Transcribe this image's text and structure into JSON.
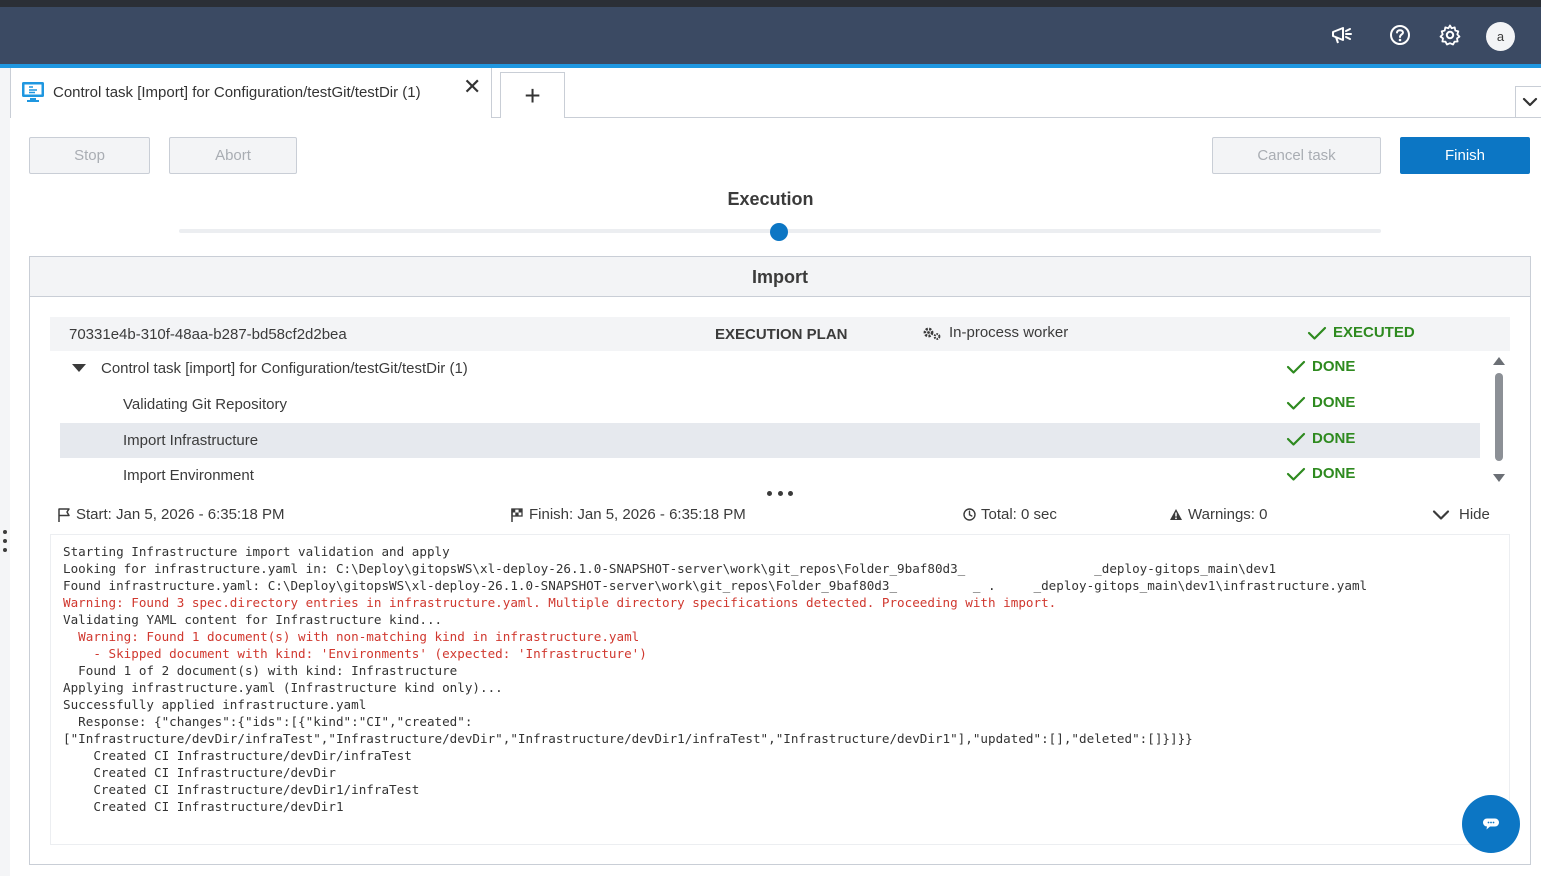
{
  "header": {
    "avatar_letter": "a",
    "icons": [
      "megaphone-icon",
      "help-icon",
      "settings-gear-icon"
    ]
  },
  "tabs": {
    "active_label": "Control task [Import] for Configuration/testGit/testDir (1)",
    "close_glyph": "✕",
    "add_glyph": "+"
  },
  "toolbar": {
    "stop_label": "Stop",
    "abort_label": "Abort",
    "cancel_label": "Cancel task",
    "finish_label": "Finish"
  },
  "stepper": {
    "current_step": "Execution"
  },
  "panel": {
    "title": "Import",
    "plan": {
      "id": "70331e4b-310f-48aa-b287-bd58cf2d2bea",
      "label": "EXECUTION PLAN",
      "worker": "In-process worker",
      "state": "EXECUTED"
    },
    "steps": [
      {
        "label": "Control task [import] for Configuration/testGit/testDir (1)",
        "status": "DONE"
      },
      {
        "label": "Validating Git Repository",
        "status": "DONE"
      },
      {
        "label": "Import Infrastructure",
        "status": "DONE"
      },
      {
        "label": "Import Environment",
        "status": "DONE"
      }
    ],
    "info": {
      "start": "Start: Jan 5, 2026 - 6:35:18 PM",
      "finish": "Finish: Jan 5, 2026 - 6:35:18 PM",
      "total": "Total: 0 sec",
      "warnings": "Warnings: 0",
      "hide_label": "Hide"
    },
    "log": [
      "Starting Infrastructure import validation and apply",
      "Looking for infrastructure.yaml in: C:\\Deploy\\gitopsWS\\xl-deploy-26.1.0-SNAPSHOT-server\\work\\git_repos\\Folder_9baf80d3_                 _deploy-gitops_main\\dev1",
      "Found infrastructure.yaml: C:\\Deploy\\gitopsWS\\xl-deploy-26.1.0-SNAPSHOT-server\\work\\git_repos\\Folder_9baf80d3_          _ .     _deploy-gitops_main\\dev1\\infrastructure.yaml",
      "Warning: Found 3 spec.directory entries in infrastructure.yaml. Multiple directory specifications detected. Proceeding with import.",
      "Validating YAML content for Infrastructure kind...",
      "  Warning: Found 1 document(s) with non-matching kind in infrastructure.yaml",
      "    - Skipped document with kind: 'Environments' (expected: 'Infrastructure')",
      "  Found 1 of 2 document(s) with kind: Infrastructure",
      "Applying infrastructure.yaml (Infrastructure kind only)...",
      "Successfully applied infrastructure.yaml",
      "  Response: {\"changes\":{\"ids\":[{\"kind\":\"CI\",\"created\":",
      "[\"Infrastructure/devDir/infraTest\",\"Infrastructure/devDir\",\"Infrastructure/devDir1/infraTest\",\"Infrastructure/devDir1\"],\"updated\":[],\"deleted\":[]}]}}",
      "    Created CI Infrastructure/devDir/infraTest",
      "    Created CI Infrastructure/devDir",
      "    Created CI Infrastructure/devDir1/infraTest",
      "    Created CI Infrastructure/devDir1"
    ],
    "warning_line_indices": [
      3,
      5,
      6
    ]
  },
  "colors": {
    "topbar": "#3b4a63",
    "accent": "#1f97e0",
    "primary_button": "#0c76c4",
    "success": "#2e8a1f",
    "warning_text": "#d0382f"
  }
}
